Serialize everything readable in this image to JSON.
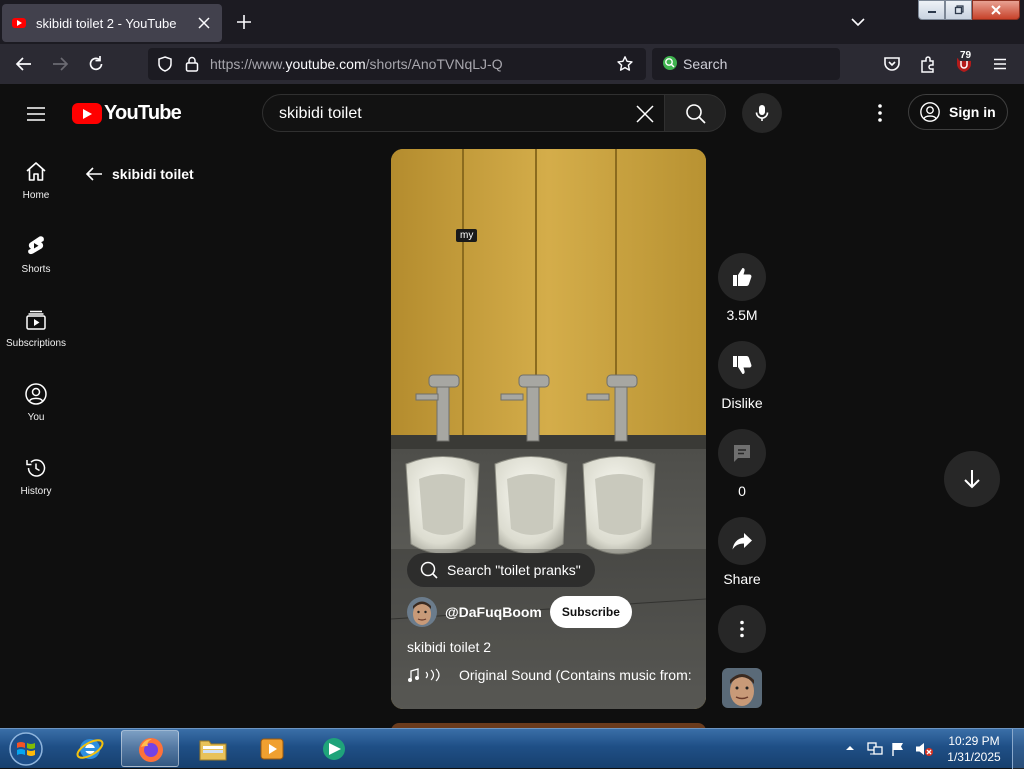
{
  "browser": {
    "tab_title": "skibidi toilet 2 - YouTube",
    "url_prefix": "https://www.",
    "url_host": "youtube.com",
    "url_path": "/shorts/AnoTVNqLJ-Q",
    "search_placeholder": "Search",
    "extensions_badge": "79"
  },
  "header": {
    "logo_text": "YouTube",
    "search_value": "skibidi toilet",
    "sign_in_label": "Sign in"
  },
  "sidebar": {
    "items": [
      {
        "label": "Home",
        "icon": "home-icon"
      },
      {
        "label": "Shorts",
        "icon": "shorts-icon"
      },
      {
        "label": "Subscriptions",
        "icon": "subscriptions-icon"
      },
      {
        "label": "You",
        "icon": "you-icon"
      },
      {
        "label": "History",
        "icon": "history-icon"
      }
    ]
  },
  "search_context": {
    "back_label": "skibidi toilet"
  },
  "video": {
    "overlay_text": "my",
    "search_chip": "Search \"toilet pranks\"",
    "channel": "@DaFuqBoom",
    "subscribe_label": "Subscribe",
    "title": "skibidi toilet 2",
    "sound_label": "Original Sound (Contains music from:"
  },
  "actions": {
    "like_count": "3.5M",
    "dislike_label": "Dislike",
    "comment_count": "0",
    "share_label": "Share"
  },
  "taskbar": {
    "time": "10:29 PM",
    "date": "1/31/2025"
  },
  "colors": {
    "youtube_red": "#ff0000",
    "page_bg": "#0f0f0f",
    "taskbar_blue": "#1f4f86"
  }
}
